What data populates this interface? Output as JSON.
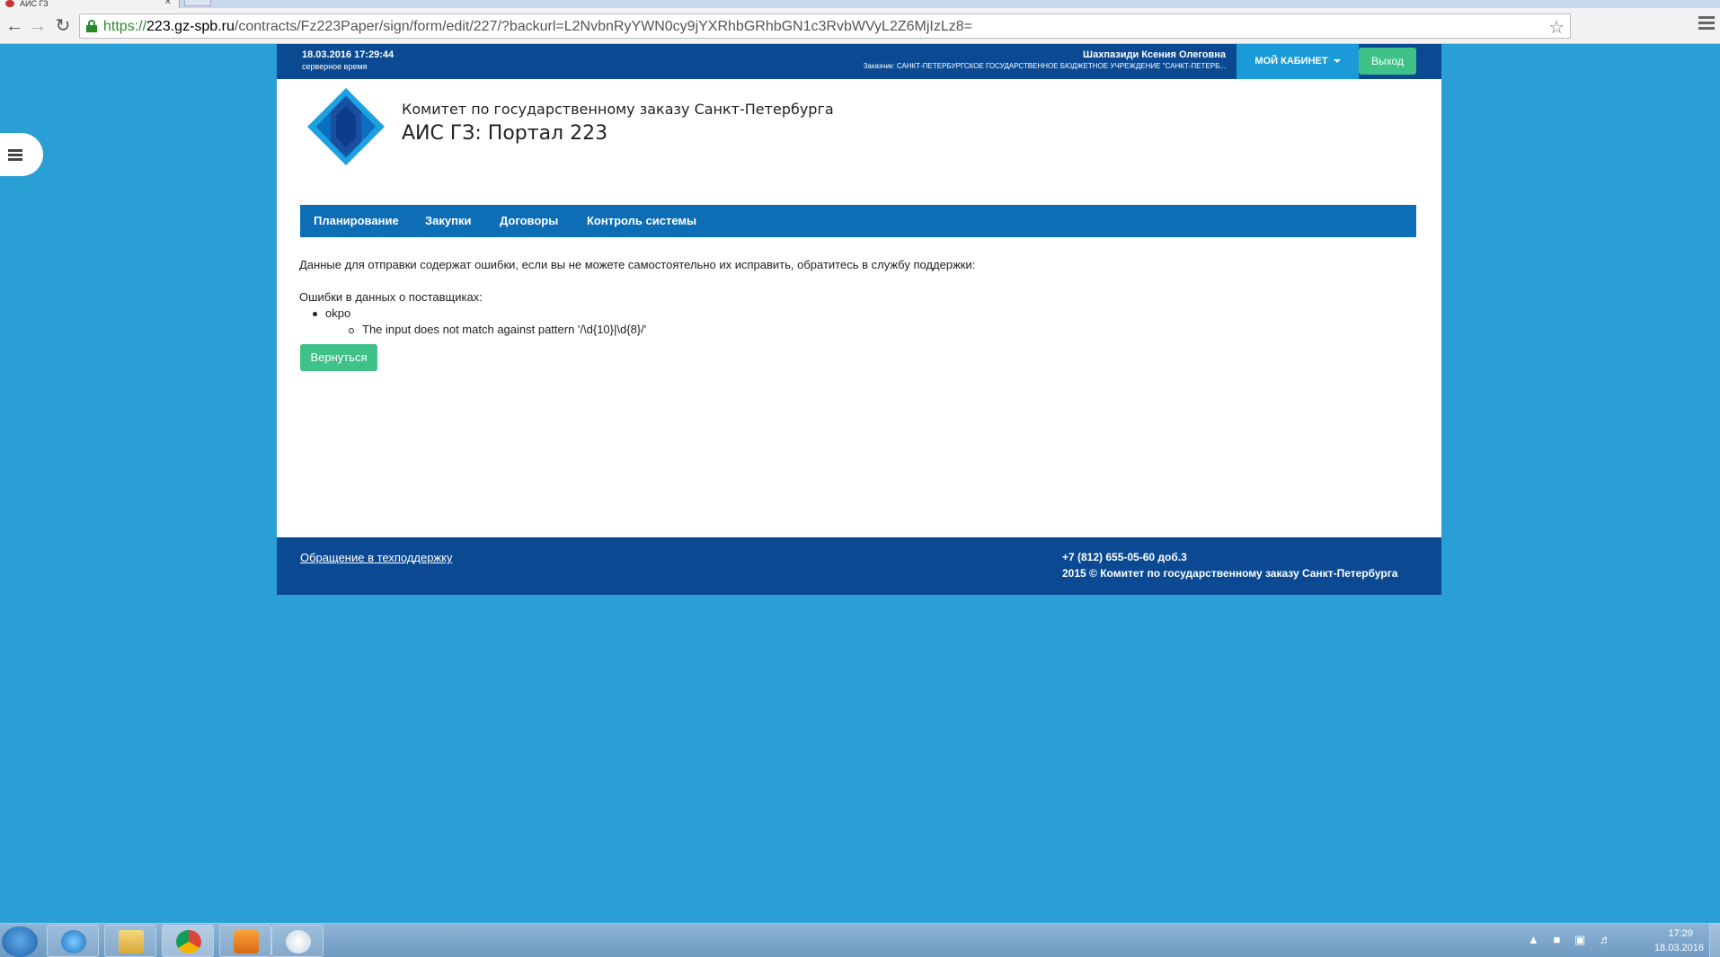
{
  "browser": {
    "tab_title": "АИС ГЗ",
    "tab_close": "✕",
    "url_scheme": "https://",
    "url_host": "223.gz-spb.ru",
    "url_path": "/contracts/Fz223Paper/sign/form/edit/227/?backurl=L2NvbnRyYWN0cy9jYXRhbGRhbGN1c3RvbWVyL2Z6MjIzLz8="
  },
  "header": {
    "datetime": "18.03.2016 17:29:44",
    "datetime_caption": "серверное время",
    "user_name": "Шахпазиди Ксения Олеговна",
    "customer": "Заказчик: САНКТ-ПЕТЕРБУРГСКОЕ ГОСУДАРСТВЕННОЕ БЮДЖЕТНОЕ УЧРЕЖДЕНИЕ \"САНКТ-ПЕТЕРБ...",
    "cabinet_label": "МОЙ КАБИНЕТ",
    "logout_label": "Выход"
  },
  "brand": {
    "org_name": "Комитет по государственному заказу Санкт-Петербурга",
    "portal_title": "АИС ГЗ: Портал 223"
  },
  "nav": {
    "items": [
      {
        "label": "Планирование"
      },
      {
        "label": "Закупки"
      },
      {
        "label": "Договоры"
      },
      {
        "label": "Контроль системы"
      }
    ]
  },
  "main": {
    "message": "Данные для отправки содержат ошибки, если вы не можете самостоятельно их исправить, обратитесь в службу поддержки:",
    "errors_heading": "Ошибки в данных о поставщиках:",
    "error_field": "okpo",
    "error_detail": "The input does not match against pattern '/\\d{10}|\\d{8}/'",
    "back_label": "Вернуться"
  },
  "footer": {
    "support_link": "Обращение в техподдержку",
    "phone": "+7 (812) 655-05-60 доб.3",
    "copyright": "2015 © Комитет по государственному заказу Санкт-Петербурга"
  },
  "taskbar": {
    "time": "17:29",
    "date": "18.03.2016",
    "apps": [
      "internet-explorer-icon",
      "file-explorer-icon",
      "chrome-icon",
      "media-player-icon",
      "snipping-tool-icon"
    ]
  },
  "colors": {
    "page_bg": "#2a9fd5",
    "header_bg": "#0b4a93",
    "nav_bg": "#0d6eb5",
    "cabinet_bg": "#1a9ad6",
    "button_green": "#3ec287"
  }
}
